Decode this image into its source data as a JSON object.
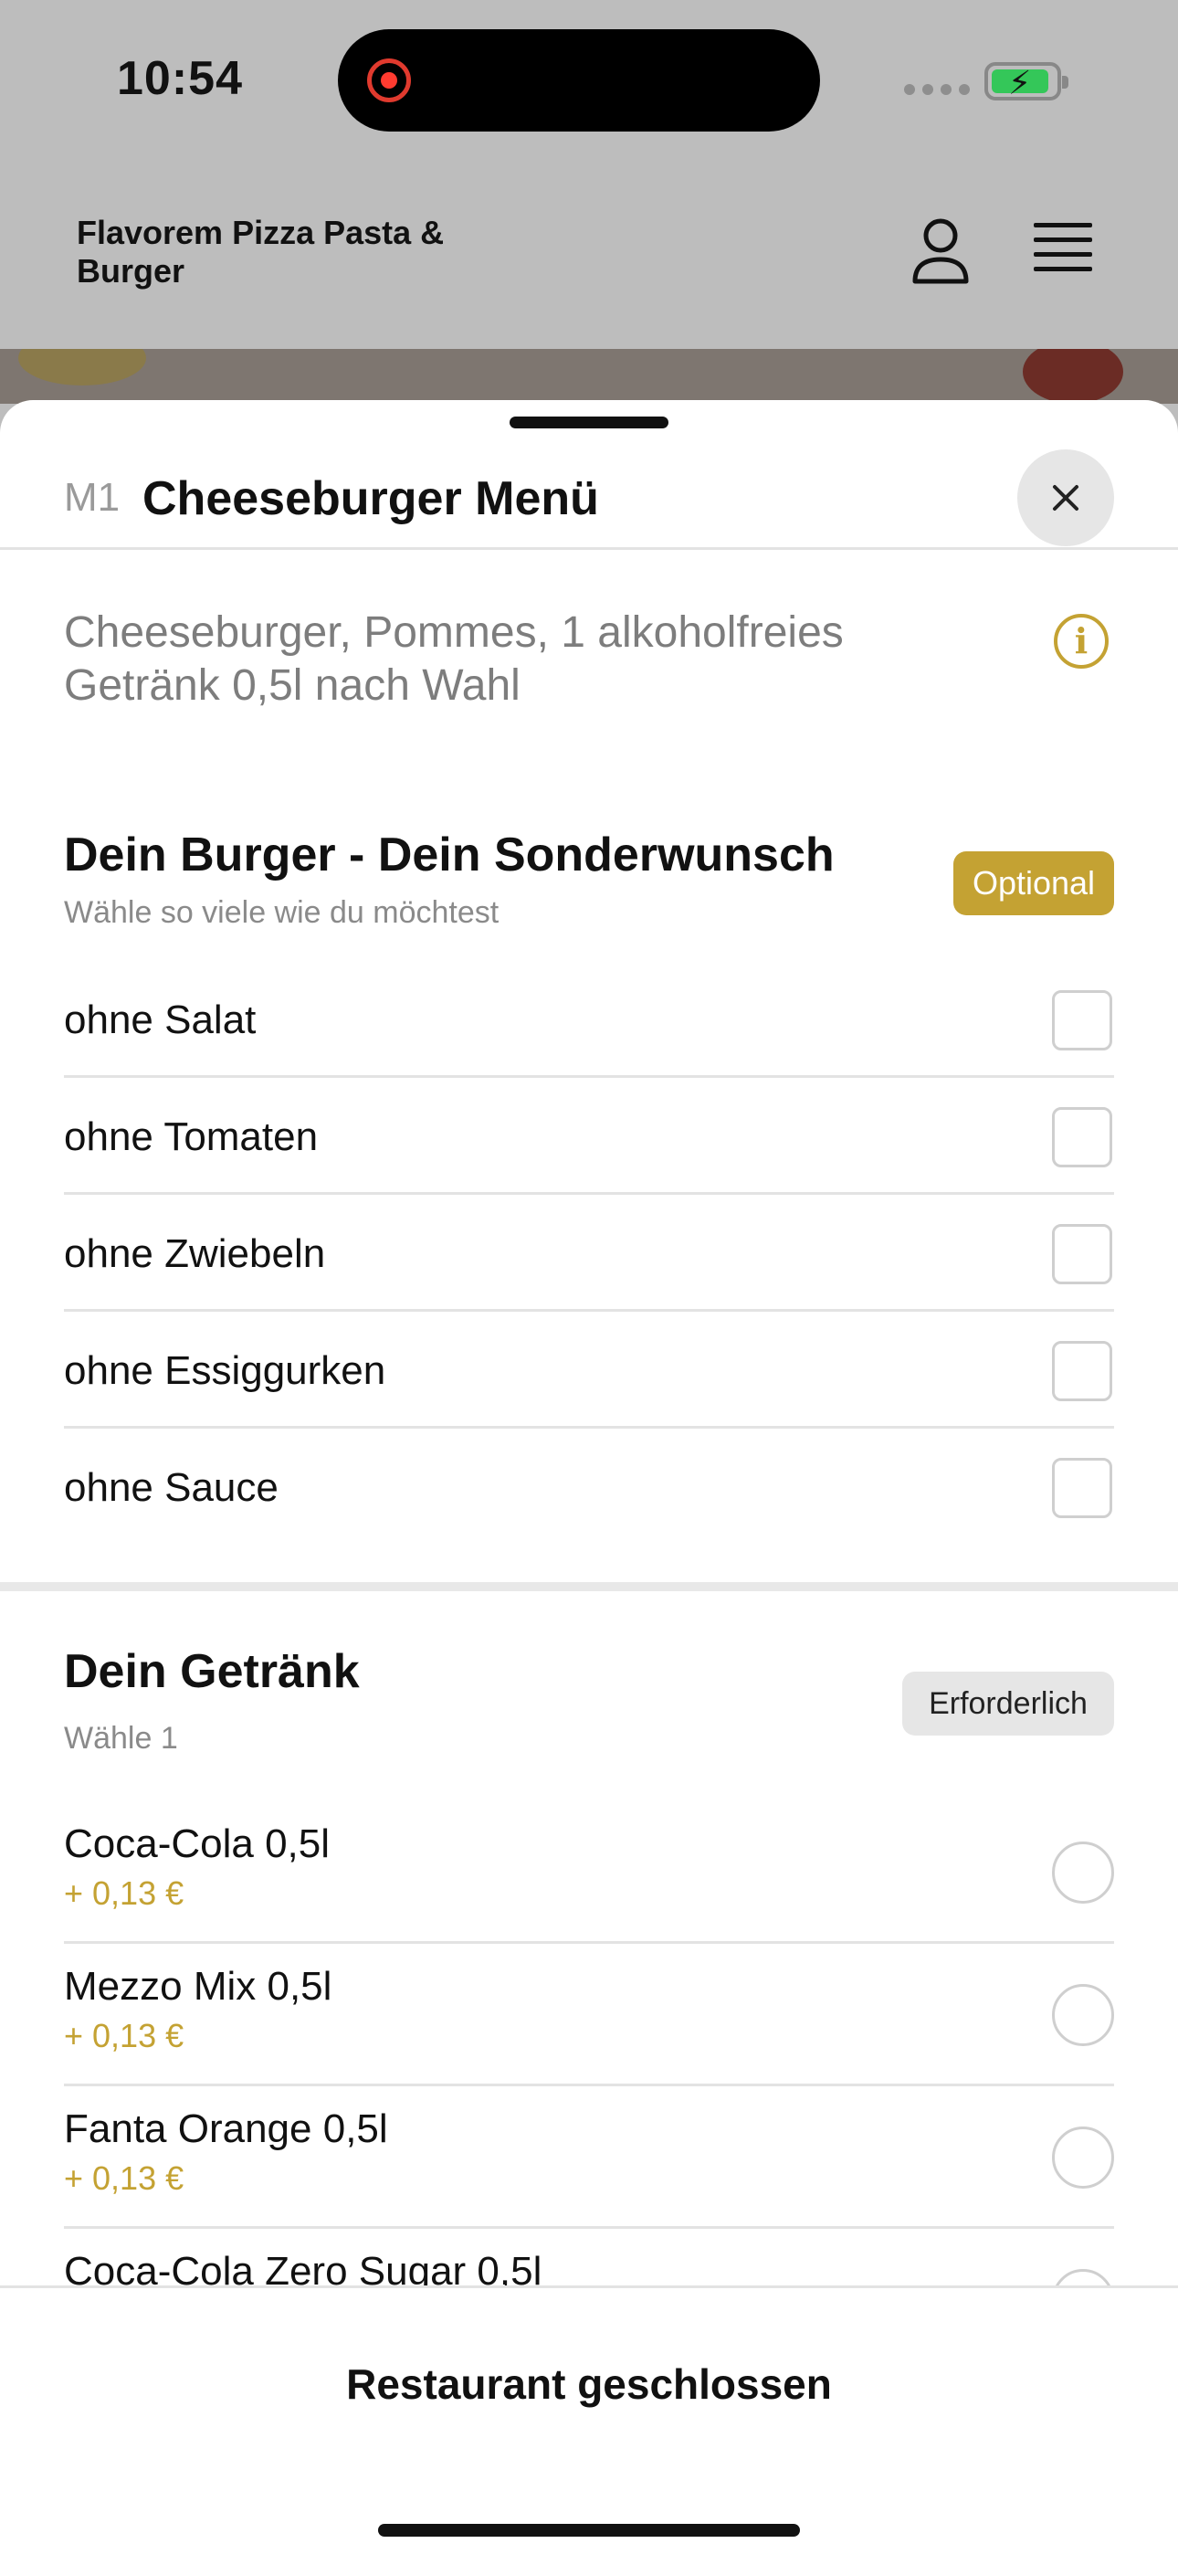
{
  "status_bar": {
    "time": "10:54"
  },
  "header": {
    "brand": "Flavorem Pizza Pasta & Burger"
  },
  "product": {
    "code": "M1",
    "title": "Cheeseburger Menü",
    "description": "Cheeseburger, Pommes, 1 alkoholfreies Getränk 0,5l nach Wahl"
  },
  "burger_section": {
    "title": "Dein Burger - Dein Sonderwunsch",
    "subtitle": "Wähle so viele wie du möchtest",
    "badge": "Optional",
    "options": [
      {
        "label": "ohne Salat"
      },
      {
        "label": "ohne Tomaten"
      },
      {
        "label": "ohne Zwiebeln"
      },
      {
        "label": "ohne Essiggurken"
      },
      {
        "label": "ohne Sauce"
      }
    ]
  },
  "drink_section": {
    "title": "Dein Getränk",
    "subtitle": "Wähle 1",
    "badge": "Erforderlich",
    "options": [
      {
        "label": "Coca-Cola 0,5l",
        "price": "+ 0,13 €"
      },
      {
        "label": "Mezzo Mix 0,5l",
        "price": "+ 0,13 €"
      },
      {
        "label": "Fanta Orange 0,5l",
        "price": "+ 0,13 €"
      },
      {
        "label": "Coca-Cola Zero Sugar 0,5l",
        "price": ""
      }
    ]
  },
  "footer": {
    "button_label": "Restaurant geschlossen"
  },
  "colors": {
    "accent": "#c4a233",
    "header_bg": "#bdbdbd"
  }
}
